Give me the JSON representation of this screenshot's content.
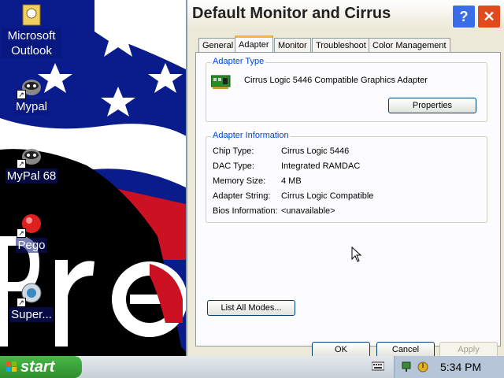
{
  "desktop": {
    "icons": [
      {
        "name": "microsoft-outlook-icon",
        "label": "Microsoft Outlook"
      },
      {
        "name": "mypal-icon",
        "label": "Mypal"
      },
      {
        "name": "mypal-68-icon",
        "label": "MyPal 68"
      },
      {
        "name": "pego-icon",
        "label": "Pego"
      },
      {
        "name": "super-icon",
        "label": "Super..."
      }
    ]
  },
  "dialog": {
    "title": "Default Monitor and Cirrus",
    "tabs": [
      "General",
      "Adapter",
      "Monitor",
      "Troubleshoot",
      "Color Management"
    ],
    "active_tab": "Adapter",
    "adapter_type": {
      "group_label": "Adapter Type",
      "adapter_name": "Cirrus Logic 5446 Compatible Graphics Adapter",
      "properties_label": "Properties"
    },
    "adapter_info": {
      "group_label": "Adapter Information",
      "rows": [
        {
          "key": "Chip Type:",
          "value": "Cirrus Logic 5446"
        },
        {
          "key": "DAC Type:",
          "value": "Integrated RAMDAC"
        },
        {
          "key": "Memory Size:",
          "value": "4 MB"
        },
        {
          "key": "Adapter String:",
          "value": "Cirrus Logic Compatible"
        },
        {
          "key": "Bios Information:",
          "value": "<unavailable>"
        }
      ]
    },
    "list_all_modes_label": "List All Modes...",
    "ok_label": "OK",
    "cancel_label": "Cancel",
    "apply_label": "Apply",
    "help_glyph": "?",
    "close_glyph": "✕"
  },
  "taskbar": {
    "start_label": "start",
    "clock": "5:34 PM"
  },
  "colors": {
    "accent_tab": "#f2b542",
    "group_label": "#0046d5",
    "start_green": "#3aa43a"
  }
}
